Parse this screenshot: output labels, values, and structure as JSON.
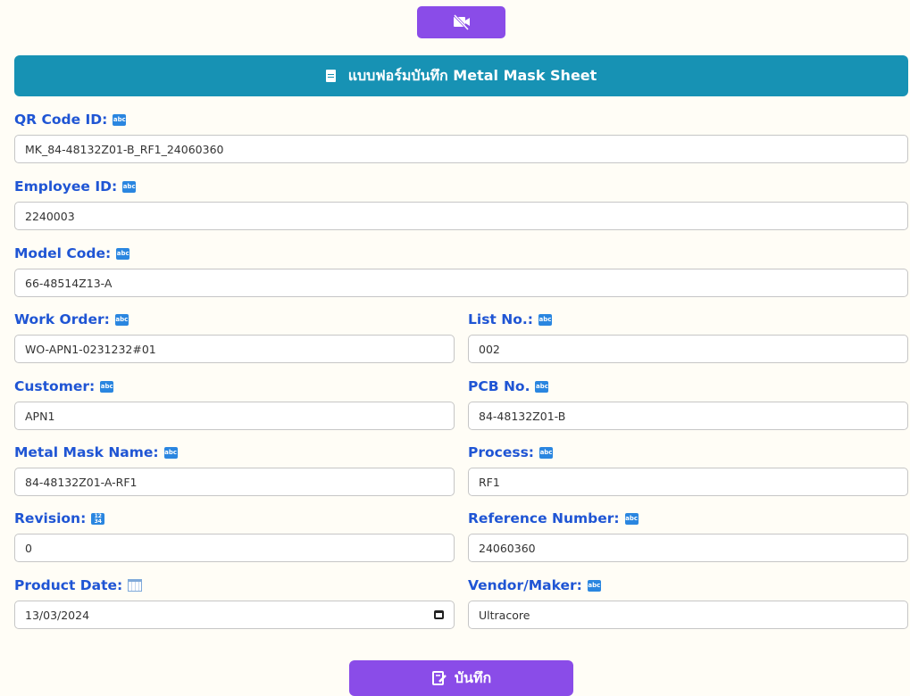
{
  "form": {
    "title": "แบบฟอร์มบันทึก Metal Mask Sheet",
    "save_label": "บันทึก",
    "fields": {
      "qr_code_id": {
        "label": "QR Code ID:",
        "value": "MK_84-48132Z01-B_RF1_24060360"
      },
      "employee_id": {
        "label": "Employee ID:",
        "value": "2240003"
      },
      "model_code": {
        "label": "Model Code:",
        "value": "66-48514Z13-A"
      },
      "work_order": {
        "label": "Work Order:",
        "value": "WO-APN1-0231232#01"
      },
      "list_no": {
        "label": "List No.:",
        "value": "002"
      },
      "customer": {
        "label": "Customer:",
        "value": "APN1"
      },
      "pcb_no": {
        "label": "PCB No.",
        "value": "84-48132Z01-B"
      },
      "metal_mask_name": {
        "label": "Metal Mask Name:",
        "value": "84-48132Z01-A-RF1"
      },
      "process": {
        "label": "Process:",
        "value": "RF1"
      },
      "revision": {
        "label": "Revision:",
        "value": "0"
      },
      "reference_number": {
        "label": "Reference Number:",
        "value": "24060360"
      },
      "product_date": {
        "label": "Product Date:",
        "value": "13/03/2024"
      },
      "vendor_maker": {
        "label": "Vendor/Maker:",
        "value": "Ultracore"
      }
    }
  },
  "badges": {
    "text": "abc",
    "numeric": "12 34"
  },
  "icons": {
    "camera_off": "camera-off-icon",
    "document": "document-icon",
    "save": "save-icon",
    "calendar": "calendar-icon"
  },
  "colors": {
    "accent_purple": "#8a4ce8",
    "banner_teal": "#1792b4",
    "label_blue": "#1f55d4"
  }
}
